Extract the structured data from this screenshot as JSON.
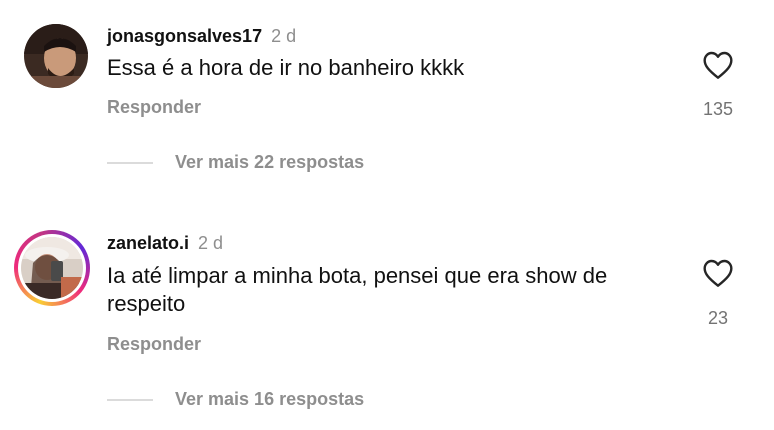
{
  "comments": [
    {
      "username": "jonasgonsalves17",
      "time": "2 d",
      "text": "Essa é a hora de ir no banheiro kkkk",
      "reply_label": "Responder",
      "likes": "135",
      "more_replies": "Ver mais 22 respostas",
      "heart_icon": "heart-outline-icon"
    },
    {
      "username": "zanelato.i",
      "time": "2 d",
      "text": "Ia até limpar a minha bota, pensei que era show de respeito",
      "reply_label": "Responder",
      "likes": "23",
      "more_replies": "Ver mais 16 respostas",
      "heart_icon": "heart-outline-icon"
    }
  ],
  "colors": {
    "secondary_text": "#8e8e8e",
    "divider": "#dbdbdb",
    "story_ring": "#ee2a7b"
  }
}
